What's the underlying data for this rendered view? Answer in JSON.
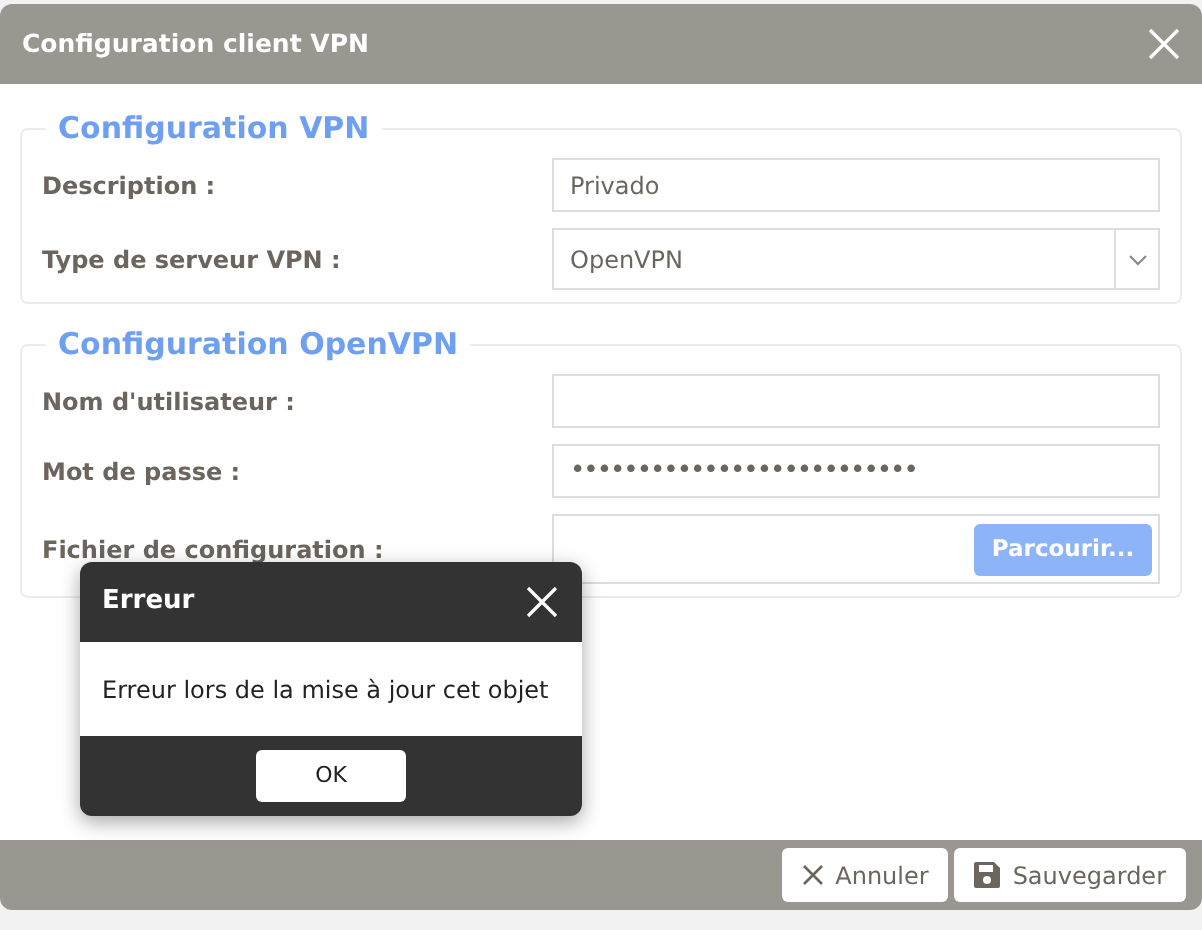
{
  "window": {
    "title": "Configuration client VPN"
  },
  "sections": [
    {
      "title": "Configuration VPN",
      "fields": [
        {
          "kind": "text",
          "label": "Description :",
          "value": "Privado"
        },
        {
          "kind": "select",
          "label": "Type de serveur VPN :",
          "value": "OpenVPN"
        }
      ]
    },
    {
      "title": "Configuration OpenVPN",
      "fields": [
        {
          "kind": "text",
          "label": "Nom d'utilisateur :"
        },
        {
          "kind": "text",
          "label": "Mot de passe :",
          "value": "••••••••••••••••••••••••••"
        },
        {
          "kind": "file",
          "label": "Fichier de configuration :",
          "button": "Parcourir..."
        }
      ]
    }
  ],
  "error_dialog": {
    "title": "Erreur",
    "message": "Erreur lors de la mise à jour cet objet",
    "button": "OK"
  },
  "footer_buttons": [
    {
      "kind": "cancel",
      "label": "Annuler"
    },
    {
      "kind": "save",
      "label": "Sauvegarder"
    }
  ]
}
